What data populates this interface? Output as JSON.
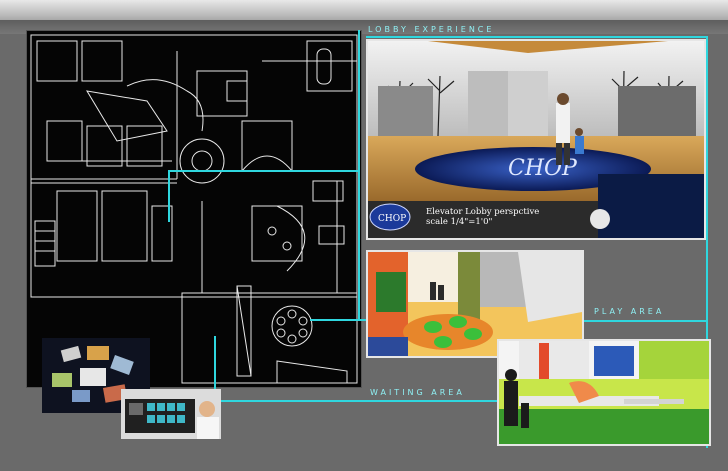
{
  "labels": {
    "lobby": "Lobby Experience",
    "play": "PLAY AREA",
    "waiting": "WAITING AREA"
  },
  "lobby_render": {
    "logo": "CHOP",
    "caption_line1": "Elevator Lobby perspctive",
    "caption_line2": "scale 1/4\"=1'0\""
  },
  "colors": {
    "accent": "#2fd7df",
    "background": "#6a6a6a",
    "plan_bg": "#050505"
  }
}
